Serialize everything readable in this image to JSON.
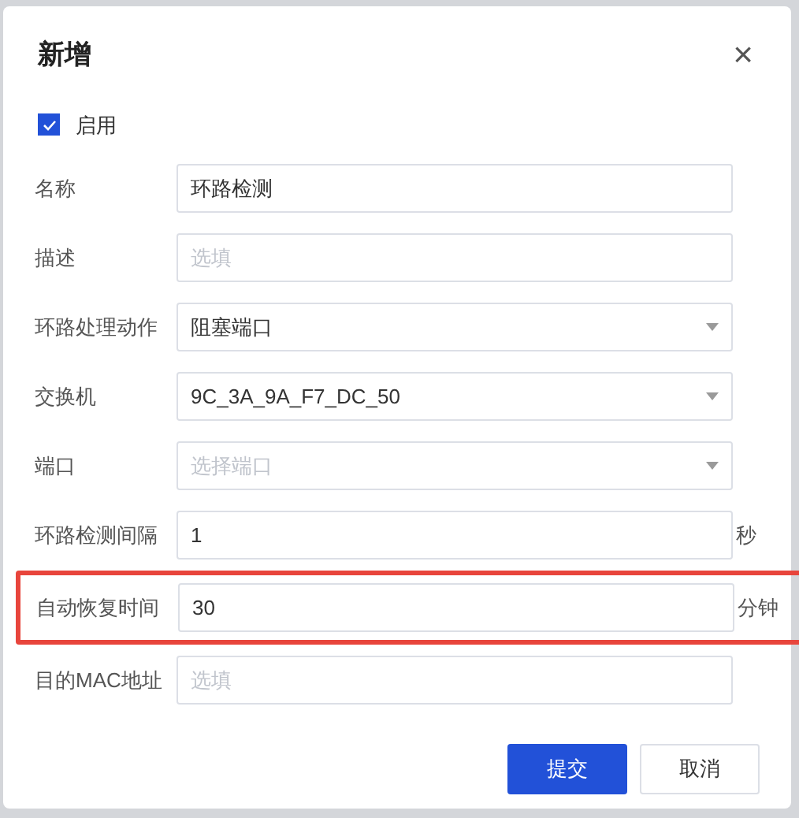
{
  "dialog": {
    "title": "新增",
    "close": "×"
  },
  "enabled": {
    "label": "启用",
    "checked": true
  },
  "fields": [
    {
      "kind": "text",
      "label": "名称",
      "value": "环路检测",
      "highlighted": false
    },
    {
      "kind": "text",
      "label": "描述",
      "placeholder": "选填",
      "highlighted": false
    },
    {
      "kind": "select",
      "label": "环路处理动作",
      "value": "阻塞端口",
      "highlighted": false
    },
    {
      "kind": "select",
      "label": "交换机",
      "value": "9C_3A_9A_F7_DC_50",
      "highlighted": false
    },
    {
      "kind": "select",
      "label": "端口",
      "placeholder": "选择端口",
      "highlighted": false
    },
    {
      "kind": "text",
      "label": "环路检测间隔",
      "value": "1",
      "unit": "秒",
      "highlighted": false
    },
    {
      "kind": "text",
      "label": "自动恢复时间",
      "value": "30",
      "unit": "分钟",
      "highlighted": true
    },
    {
      "kind": "text",
      "label": "目的MAC地址",
      "placeholder": "选填",
      "highlighted": false
    }
  ],
  "buttons": [
    {
      "label": "提交",
      "kind": "primary"
    },
    {
      "label": "取消",
      "kind": "secondary"
    }
  ]
}
